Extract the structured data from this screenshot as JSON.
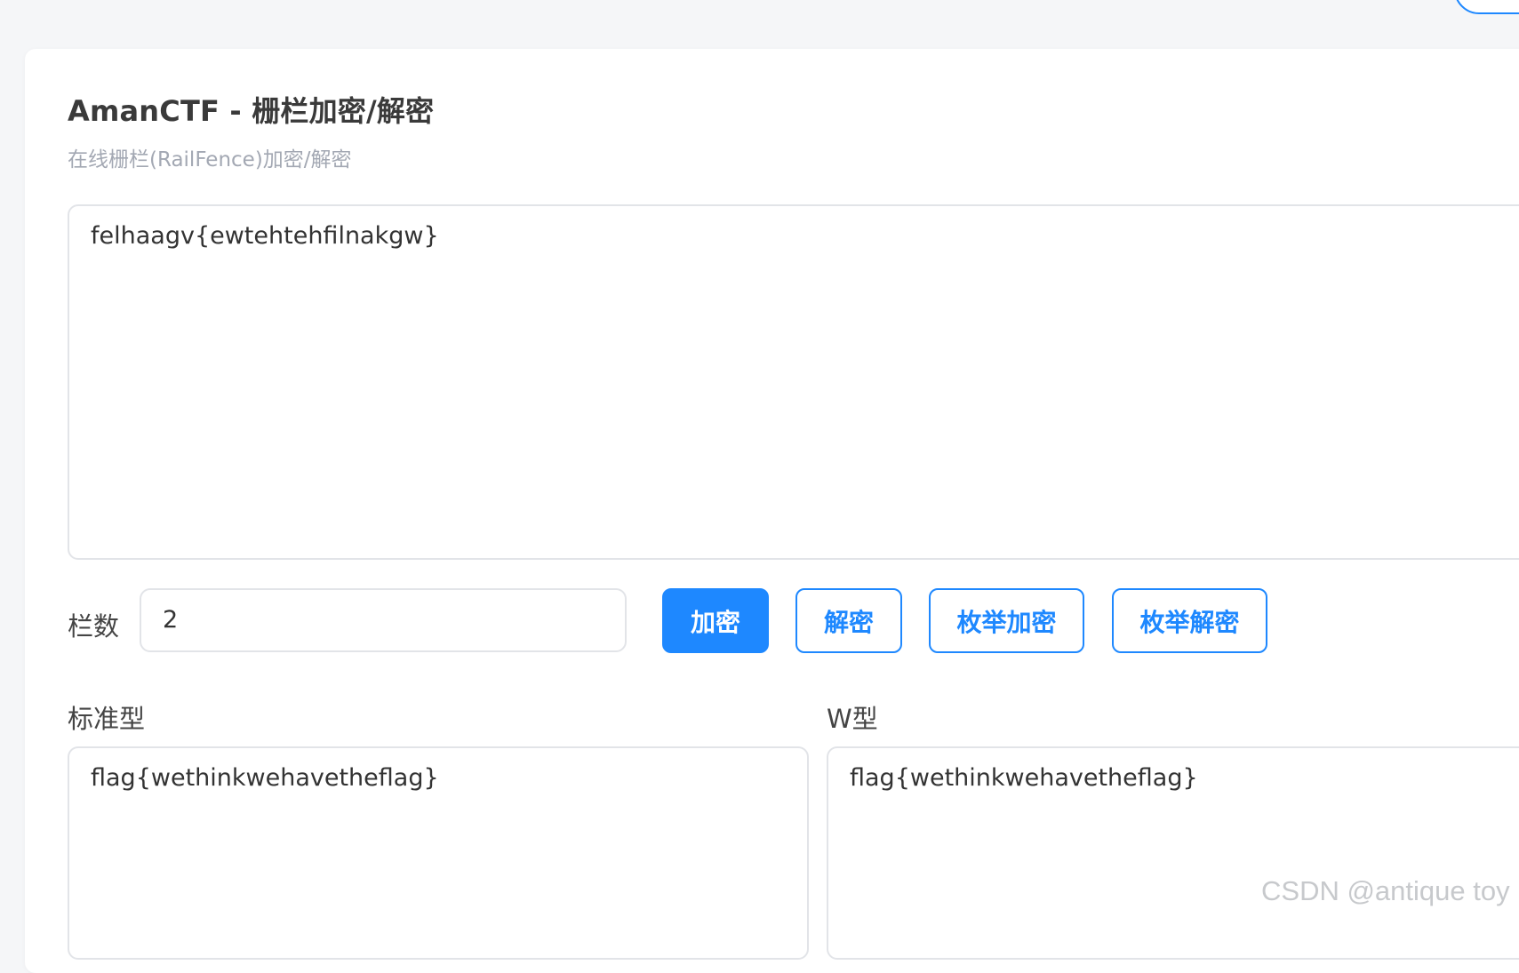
{
  "header": {
    "title": "AmanCTF - 栅栏加密/解密",
    "subtitle": "在线栅栏(RailFence)加密/解密"
  },
  "main_input": {
    "value": "felhaagv{ewtehtehfilnakgw}"
  },
  "controls": {
    "rails_label": "栏数",
    "rails_value": "2",
    "encrypt_label": "加密",
    "decrypt_label": "解密",
    "enum_encrypt_label": "枚举加密",
    "enum_decrypt_label": "枚举解密"
  },
  "outputs": {
    "standard_label": "标准型",
    "standard_value": "flag{wethinkwehavetheflag}",
    "w_label": "W型",
    "w_value": "flag{wethinkwehavetheflag}"
  },
  "watermark": "CSDN @antique toy",
  "colors": {
    "accent": "#1e88ff",
    "background": "#f5f6f8",
    "card": "#ffffff",
    "border": "#e2e4e8",
    "subtitle": "#a3a8b3"
  }
}
